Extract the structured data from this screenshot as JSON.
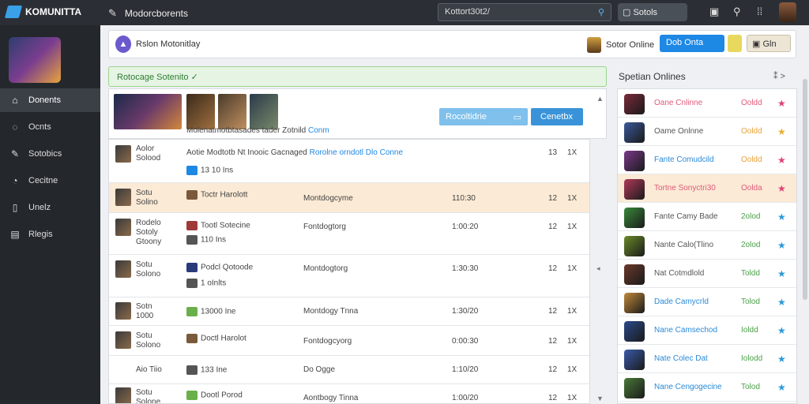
{
  "topbar": {
    "brand": "KOMUNITTA",
    "title": "Modorcborents",
    "search": "Kottort30t2/",
    "button": "Sotols"
  },
  "sidebar": {
    "items": [
      {
        "label": "Donents",
        "icon": "home-icon"
      },
      {
        "label": "Ocnts",
        "icon": "chat-icon"
      },
      {
        "label": "Sotobics",
        "icon": "pen-icon"
      },
      {
        "label": "Cecitne",
        "icon": "gauge-icon"
      },
      {
        "label": "Unelz",
        "icon": "doc-icon"
      },
      {
        "label": "Rlegis",
        "icon": "image-icon"
      }
    ]
  },
  "header": {
    "title": "Rslon Motonitlay",
    "online_label": "Sotor Online",
    "blue_button": "Dob Onta",
    "gray_button": "Gln"
  },
  "success": "Rotocage Sotenito ✓",
  "media": {
    "caption": "Molenatmotbtasades tader Zotnild",
    "caption_link": "Conm",
    "btn_light": "Rocoltidrie",
    "btn_dark": "Cenetbx"
  },
  "table": {
    "header_row": {
      "c1a": "Aolor",
      "c1b": "Solood",
      "c2": "Aotie Modtotb Nt Inooic Gacnaged",
      "c2_link": "Rorolne orndotl Dlo Conne",
      "c2_sub": "13 10 Ins",
      "c5": "13",
      "c6": "1X"
    },
    "rows": [
      {
        "c1a": "Sotu",
        "c1b": "Solino",
        "c2": "Toctr Harolott",
        "c2_sub": "",
        "c3": "Montdogcyme",
        "c4": "110:30",
        "c5": "12",
        "c6": "1X",
        "hl": true
      },
      {
        "c1a": "Rodelo",
        "c1b": "Sotoly",
        "c1c": "Gtoony",
        "c2": "Tootl Sotecine",
        "c2_sub": "110 Ins",
        "c3": "Fontdogtorg",
        "c4": "1:00:20",
        "c5": "12",
        "c6": "1X",
        "hl": false
      },
      {
        "c1a": "Sotu",
        "c1b": "Solono",
        "c2": "Podcl Qotoode",
        "c2_sub": "1 oInlts",
        "c3": "Montdogtorg",
        "c4": "1:30:30",
        "c5": "12",
        "c6": "1X",
        "hl": false
      },
      {
        "c1a": "Sotn",
        "c1b": "1000",
        "c2": "13000 Ine",
        "c2_sub": "",
        "c3": "Montdogy Tnna",
        "c4": "1:30/20",
        "c5": "12",
        "c6": "1X",
        "hl": false
      },
      {
        "c1a": "Sotu",
        "c1b": "Solono",
        "c2": "Doctl Harolot",
        "c2_sub": "",
        "c3": "Fontdogcyorg",
        "c4": "0:00:30",
        "c5": "12",
        "c6": "1X",
        "hl": false
      },
      {
        "c1a": "Aio Tiio",
        "c1b": "",
        "c2": "133 Ine",
        "c2_sub": "",
        "c3": "Do Ogge",
        "c4": "1:10/20",
        "c5": "12",
        "c6": "1X",
        "hl": false
      },
      {
        "c1a": "Sotu",
        "c1b": "Solone",
        "c2": "Dootl Porod",
        "c2_sub": "",
        "c3": "Aontbogy Tinna",
        "c4": "1:00/20",
        "c5": "12",
        "c6": "1X",
        "hl": false
      }
    ]
  },
  "right": {
    "title": "Spetian Onlines",
    "items": [
      {
        "name": "Oane Cnlinne",
        "stat": "Ooldd",
        "name_color": "#e05a7a",
        "stat_color": "#e05a7a",
        "star_color": "#e0407a",
        "img": "#7a2a3a",
        "hl": false
      },
      {
        "name": "Oame Onlnne",
        "stat": "Ooldd",
        "name_color": "#555555",
        "stat_color": "#e8a33b",
        "star_color": "#e8b030",
        "img": "#3a5a9a",
        "hl": false
      },
      {
        "name": "Fante Comudcild",
        "stat": "Ooldd",
        "name_color": "#2a8ad8",
        "stat_color": "#e8a33b",
        "star_color": "#e0407a",
        "img": "#7a3a8a",
        "hl": false
      },
      {
        "name": "Tortne Sonyctri30",
        "stat": "Oolda",
        "name_color": "#e05a7a",
        "stat_color": "#e05a7a",
        "star_color": "#e0407a",
        "img": "#b03a5a",
        "hl": true
      },
      {
        "name": "Fante Camy Bade",
        "stat": "2olod",
        "name_color": "#555555",
        "stat_color": "#4aa04a",
        "star_color": "#2a9ad8",
        "img": "#3a8a3a",
        "hl": false
      },
      {
        "name": "Nante Calo(Tlino",
        "stat": "2olod",
        "name_color": "#555555",
        "stat_color": "#4aa04a",
        "star_color": "#2a9ad8",
        "img": "#6a8a2a",
        "hl": false
      },
      {
        "name": "Nat Cotmdlold",
        "stat": "Toldd",
        "name_color": "#555555",
        "stat_color": "#4aa04a",
        "star_color": "#2a9ad8",
        "img": "#6a3a2a",
        "hl": false
      },
      {
        "name": "Dade Camycrld",
        "stat": "Tolod",
        "name_color": "#2a8ad8",
        "stat_color": "#4aa04a",
        "star_color": "#2a9ad8",
        "img": "#c08a3a",
        "hl": false
      },
      {
        "name": "Nane Camsechod",
        "stat": "Ioldd",
        "name_color": "#2a8ad8",
        "stat_color": "#4aa04a",
        "star_color": "#2a9ad8",
        "img": "#2a4a8a",
        "hl": false
      },
      {
        "name": "Nate Colec Dat",
        "stat": "Iolodd",
        "name_color": "#2a8ad8",
        "stat_color": "#4aa04a",
        "star_color": "#2a9ad8",
        "img": "#3a5aaa",
        "hl": false
      },
      {
        "name": "Nane Cengogecine",
        "stat": "Tolod",
        "name_color": "#2a8ad8",
        "stat_color": "#4aa04a",
        "star_color": "#2a9ad8",
        "img": "#4a7a3a",
        "hl": false
      }
    ]
  }
}
